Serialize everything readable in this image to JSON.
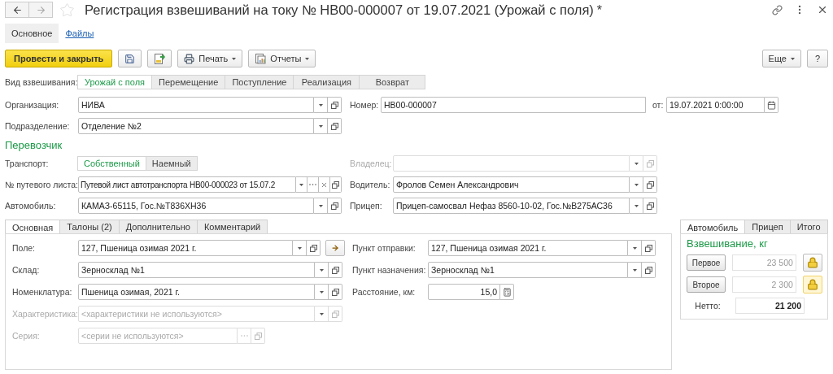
{
  "window": {
    "title": "Регистрация взвешиваний на току № НВ00-000007 от 19.07.2021 (Урожай с поля)",
    "modified_mark": "*"
  },
  "sections": [
    {
      "label": "Основное",
      "selected": true
    },
    {
      "label": "Файлы",
      "selected": false
    }
  ],
  "toolbar": {
    "commit": "Провести и закрыть",
    "print": "Печать",
    "reports": "Отчеты",
    "more": "Еще",
    "help": "?"
  },
  "weighing_type": {
    "label": "Вид взвешивания:",
    "options": [
      {
        "label": "Урожай с поля",
        "selected": true
      },
      {
        "label": "Перемещение",
        "selected": false
      },
      {
        "label": "Поступление",
        "selected": false
      },
      {
        "label": "Реализация",
        "selected": false
      },
      {
        "label": "Возврат",
        "selected": false
      }
    ]
  },
  "header": {
    "organization": {
      "label": "Организация:",
      "value": "НИВА",
      "buttons": [
        {
          "kind": "dropdown"
        },
        {
          "kind": "open"
        }
      ]
    },
    "number": {
      "label": "Номер:",
      "value": "НВ00-000007"
    },
    "date": {
      "label": "от:",
      "value": "19.07.2021  0:00:00",
      "buttons": [
        {
          "kind": "calendar"
        }
      ]
    },
    "department": {
      "label": "Подразделение:",
      "value": "Отделение №2",
      "buttons": [
        {
          "kind": "dropdown"
        },
        {
          "kind": "open"
        }
      ]
    }
  },
  "carrier": {
    "heading": "Перевозчик",
    "transport": {
      "label": "Транспорт:",
      "options": [
        {
          "label": "Собственный",
          "selected": true
        },
        {
          "label": "Наемный",
          "selected": false
        }
      ]
    },
    "owner": {
      "label": "Владелец:",
      "disabled": true,
      "buttons": [
        {
          "kind": "dropdown"
        },
        {
          "kind": "open"
        }
      ]
    },
    "waybill": {
      "label": "№ путевого листа:",
      "value": "Путевой лист автотранспорта НВ00-000023 от 15.07.2",
      "buttons": [
        {
          "kind": "dropdown"
        },
        {
          "kind": "select"
        },
        {
          "kind": "clear"
        },
        {
          "kind": "open"
        }
      ]
    },
    "driver": {
      "label": "Водитель:",
      "value": "Фролов Семен Александрович",
      "buttons": [
        {
          "kind": "dropdown"
        },
        {
          "kind": "open"
        }
      ]
    },
    "vehicle": {
      "label": "Автомобиль:",
      "value": "КАМАЗ-65115, Гос.№Т836ХН36",
      "buttons": [
        {
          "kind": "dropdown"
        },
        {
          "kind": "open"
        }
      ]
    },
    "trailer": {
      "label": "Прицеп:",
      "value": "Прицеп-самосвал Нефаз 8560-10-02, Гос.№В275АС36",
      "buttons": [
        {
          "kind": "dropdown"
        },
        {
          "kind": "open"
        }
      ]
    }
  },
  "tabs": [
    {
      "label": "Основная",
      "selected": true
    },
    {
      "label": "Талоны (2)",
      "selected": false
    },
    {
      "label": "Дополнительно",
      "selected": false
    },
    {
      "label": "Комментарий",
      "selected": false
    }
  ],
  "main_tab": {
    "field": {
      "label": "Поле:",
      "value": "127, Пшеница озимая 2021 г.",
      "buttons": [
        {
          "kind": "dropdown"
        },
        {
          "kind": "open"
        }
      ]
    },
    "warehouse": {
      "label": "Склад:",
      "value": "Зерносклад №1",
      "buttons": [
        {
          "kind": "dropdown"
        },
        {
          "kind": "open"
        }
      ]
    },
    "nomenclature": {
      "label": "Номенклатура:",
      "value": "Пшеница озимая, 2021 г.",
      "buttons": [
        {
          "kind": "dropdown"
        },
        {
          "kind": "open"
        }
      ]
    },
    "characteristic": {
      "label": "Характеристика:",
      "placeholder": "<характеристики не используются>",
      "disabled": true,
      "buttons": [
        {
          "kind": "dropdown"
        },
        {
          "kind": "open"
        }
      ]
    },
    "series": {
      "label": "Серия:",
      "placeholder": "<серии не используются>",
      "disabled": true,
      "buttons": [
        {
          "kind": "select"
        },
        {
          "kind": "open"
        }
      ]
    },
    "departure": {
      "label": "Пункт отправки:",
      "value": "127, Пшеница озимая 2021 г.",
      "buttons": [
        {
          "kind": "dropdown"
        },
        {
          "kind": "open"
        }
      ]
    },
    "destination": {
      "label": "Пункт назначения:",
      "value": "Зерносклад №1",
      "buttons": [
        {
          "kind": "dropdown"
        },
        {
          "kind": "open"
        }
      ]
    },
    "distance": {
      "label": "Расстояние, км:",
      "value": "15,0",
      "buttons": [
        {
          "kind": "calculator"
        }
      ]
    }
  },
  "weighing_panel": {
    "tabs": [
      {
        "label": "Автомобиль",
        "selected": true
      },
      {
        "label": "Прицеп",
        "selected": false
      },
      {
        "label": "Итого",
        "selected": false
      }
    ],
    "heading": "Взвешивание, кг",
    "rows": [
      {
        "button": "Первое",
        "value": "23 500",
        "focused": false
      },
      {
        "button": "Второе",
        "value": "2 300",
        "focused": true
      }
    ],
    "net": {
      "label": "Нетто:",
      "value": "21 200"
    }
  }
}
